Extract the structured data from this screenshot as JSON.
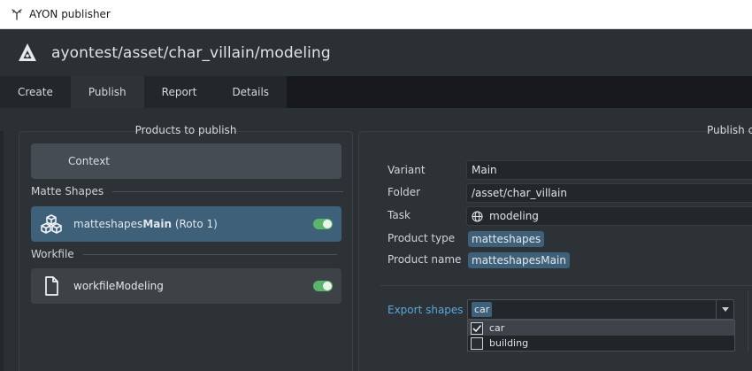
{
  "window": {
    "title": "AYON publisher"
  },
  "header": {
    "context_path": "ayontest/asset/char_villain/modeling"
  },
  "tabs": [
    {
      "label": "Create",
      "active": false
    },
    {
      "label": "Publish",
      "active": true
    },
    {
      "label": "Report",
      "active": false
    },
    {
      "label": "Details",
      "active": false
    }
  ],
  "products_panel": {
    "title": "Products to publish",
    "context_label": "Context",
    "groups": [
      {
        "label": "Matte Shapes",
        "items": [
          {
            "name_prefix": "matteshapes",
            "name_bold": "Main",
            "name_suffix": " (Roto 1)",
            "icon": "cubes-icon",
            "enabled": true,
            "selected": true
          }
        ]
      },
      {
        "label": "Workfile",
        "items": [
          {
            "name": "workfileModeling",
            "icon": "file-icon",
            "enabled": true,
            "selected": false
          }
        ]
      }
    ]
  },
  "details_panel": {
    "title": "Publish c",
    "attributes": {
      "variant": {
        "label": "Variant",
        "value": "Main"
      },
      "folder": {
        "label": "Folder",
        "value": "/asset/char_villain"
      },
      "task": {
        "label": "Task",
        "value": "modeling",
        "icon": "globe-icon"
      },
      "product_type": {
        "label": "Product type",
        "value": "matteshapes"
      },
      "product_name": {
        "label": "Product name",
        "value": "matteshapesMain"
      }
    },
    "export_shapes": {
      "label": "Export shapes",
      "selected_chip": "car",
      "options": [
        {
          "label": "car",
          "checked": true
        },
        {
          "label": "building",
          "checked": false
        }
      ]
    }
  },
  "colors": {
    "accent_blue": "#3f6079",
    "label_blue": "#5aa6dc",
    "toggle_green": "#5bb46b"
  }
}
